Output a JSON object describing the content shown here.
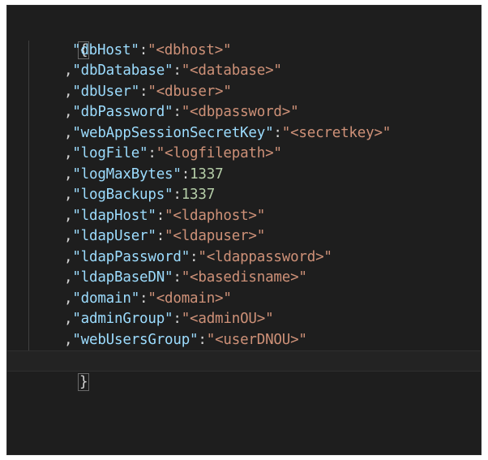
{
  "editor": {
    "open_brace": "{",
    "close_brace": "}",
    "entries": [
      {
        "comma": "",
        "key": "\"dbHost\"",
        "sep": ":",
        "value": "\"<dbhost>\"",
        "kind": "str"
      },
      {
        "comma": ",",
        "key": "\"dbDatabase\"",
        "sep": ":",
        "value": "\"<database>\"",
        "kind": "str"
      },
      {
        "comma": ",",
        "key": "\"dbUser\"",
        "sep": ":",
        "value": "\"<dbuser>\"",
        "kind": "str"
      },
      {
        "comma": ",",
        "key": "\"dbPassword\"",
        "sep": ":",
        "value": "\"<dbpassword>\"",
        "kind": "str"
      },
      {
        "comma": ",",
        "key": "\"webAppSessionSecretKey\"",
        "sep": ":",
        "value": "\"<secretkey>\"",
        "kind": "str"
      },
      {
        "comma": ",",
        "key": "\"logFile\"",
        "sep": ":",
        "value": "\"<logfilepath>\"",
        "kind": "str"
      },
      {
        "comma": ",",
        "key": "\"logMaxBytes\"",
        "sep": ":",
        "value": "1337",
        "kind": "num"
      },
      {
        "comma": ",",
        "key": "\"logBackups\"",
        "sep": ":",
        "value": "1337",
        "kind": "num"
      },
      {
        "comma": ",",
        "key": "\"ldapHost\"",
        "sep": ":",
        "value": "\"<ldaphost>\"",
        "kind": "str"
      },
      {
        "comma": ",",
        "key": "\"ldapUser\"",
        "sep": ":",
        "value": "\"<ldapuser>\"",
        "kind": "str"
      },
      {
        "comma": ",",
        "key": "\"ldapPassword\"",
        "sep": ":",
        "value": "\"<ldappassword>\"",
        "kind": "str"
      },
      {
        "comma": ",",
        "key": "\"ldapBaseDN\"",
        "sep": ":",
        "value": "\"<basedisname>\"",
        "kind": "str"
      },
      {
        "comma": ",",
        "key": "\"domain\"",
        "sep": ":",
        "value": "\"<domain>\"",
        "kind": "str"
      },
      {
        "comma": ",",
        "key": "\"adminGroup\"",
        "sep": ":",
        "value": "\"<adminOU>\"",
        "kind": "str"
      },
      {
        "comma": ",",
        "key": "\"webUsersGroup\"",
        "sep": ":",
        "value": "\"<userDNOU>\"",
        "kind": "str"
      }
    ]
  },
  "colors": {
    "background": "#1e1e1e",
    "key": "#9cdcfe",
    "string": "#ce9178",
    "number": "#b5cea8",
    "punctuation": "#d4d4d4"
  }
}
